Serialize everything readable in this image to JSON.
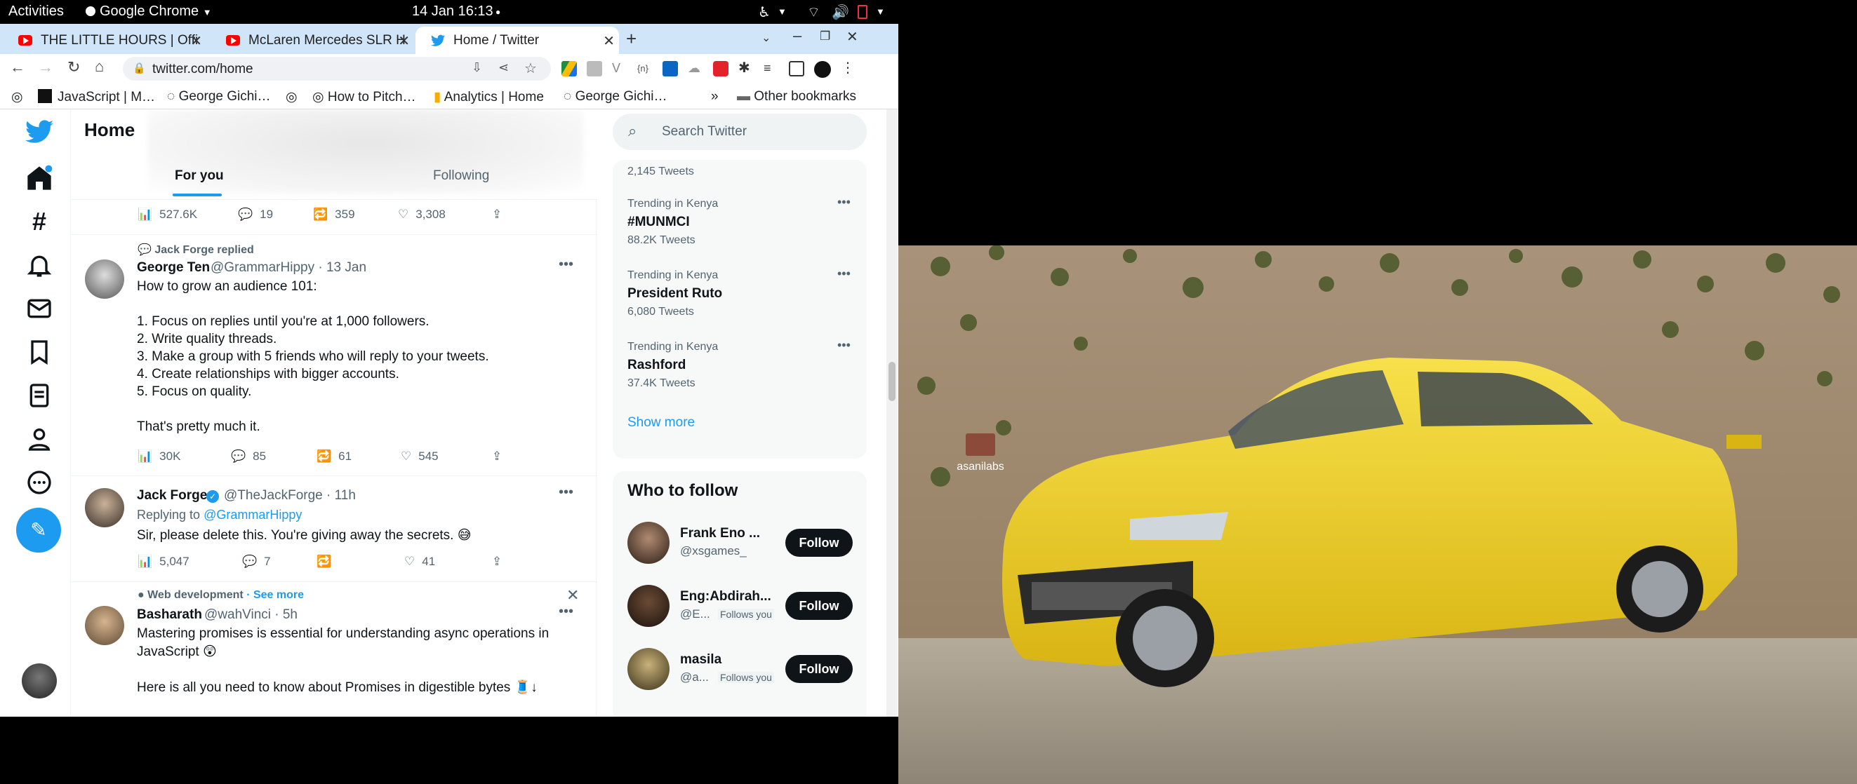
{
  "system": {
    "activities": "Activities",
    "app": "Google Chrome",
    "datetime": "14 Jan  16:13"
  },
  "tabs": [
    {
      "title": "THE LITTLE HOURS | Offic",
      "favicon": "youtube-icon"
    },
    {
      "title": "McLaren Mercedes SLR H",
      "favicon": "youtube-icon"
    },
    {
      "title": "Home / Twitter",
      "favicon": "twitter-icon"
    }
  ],
  "address": {
    "url": "twitter.com/home"
  },
  "bookmarks": [
    {
      "label": "JavaScript | M…"
    },
    {
      "label": "George Gichi…"
    },
    {
      "label": "How to Pitch…"
    },
    {
      "label": "Analytics | Home"
    },
    {
      "label": "George Gichi…"
    }
  ],
  "bookmarks_overflow": "»",
  "other_bookmarks": "Other bookmarks",
  "feed": {
    "title": "Home",
    "tab_for_you": "For you",
    "tab_following": "Following",
    "top_stats": {
      "views": "527.6K",
      "replies": "19",
      "retweets": "359",
      "likes": "3,308"
    },
    "tweet1": {
      "context": "Jack Forge replied",
      "name": "George Ten",
      "handle": "@GrammarHippy · 13 Jan",
      "lines": [
        "How to grow an audience 101:",
        "1. Focus on replies until you're at 1,000 followers.",
        "2. Write quality threads.",
        "3. Make a group with 5 friends who will reply to your tweets.",
        "4. Create relationships with bigger accounts.",
        "5. Focus on quality.",
        "That's pretty much it."
      ],
      "stats": {
        "views": "30K",
        "replies": "85",
        "retweets": "61",
        "likes": "545"
      }
    },
    "tweet2": {
      "name": "Jack Forge",
      "handle": "@TheJackForge · 11h",
      "replying_prefix": "Replying to ",
      "replying_to": "@GrammarHippy",
      "text": "Sir, please delete this. You're giving away the secrets. 😅",
      "stats": {
        "views": "5,047",
        "replies": "7",
        "retweets": "",
        "likes": "41"
      }
    },
    "tweet3": {
      "topic": "Web development",
      "see_more": "· See more",
      "name": "Basharath",
      "handle": "@wahVinci · 5h",
      "line1": "Mastering promises is essential for understanding async operations in",
      "line2": "JavaScript 😲",
      "line3": "Here is all you need to know about Promises in digestible bytes 🧵↓"
    }
  },
  "sidebar": {
    "search_placeholder": "Search Twitter",
    "trend0_count": "2,145 Tweets",
    "trends": [
      {
        "context": "Trending in Kenya",
        "name": "#MUNMCI",
        "count": "88.2K Tweets"
      },
      {
        "context": "Trending in Kenya",
        "name": "President Ruto",
        "count": "6,080 Tweets"
      },
      {
        "context": "Trending in Kenya",
        "name": "Rashford",
        "count": "37.4K Tweets"
      }
    ],
    "show_more": "Show more",
    "who_to_follow": "Who to follow",
    "follow": [
      {
        "name": "Frank Eno ...",
        "handle": "@xsgames_",
        "follows_you": "",
        "button": "Follow"
      },
      {
        "name": "Eng:Abdirah...",
        "handle": "@E...",
        "follows_you": "Follows you",
        "button": "Follow"
      },
      {
        "name": "masila",
        "handle": "@a...",
        "follows_you": "Follows you",
        "button": "Follow"
      }
    ]
  },
  "desktop": {
    "folder_label": "asanilabs"
  },
  "colors": {
    "twitter_blue": "#1d9bf0",
    "tab_strip": "#d0e5f8",
    "car_yellow": "#f2d51f"
  }
}
